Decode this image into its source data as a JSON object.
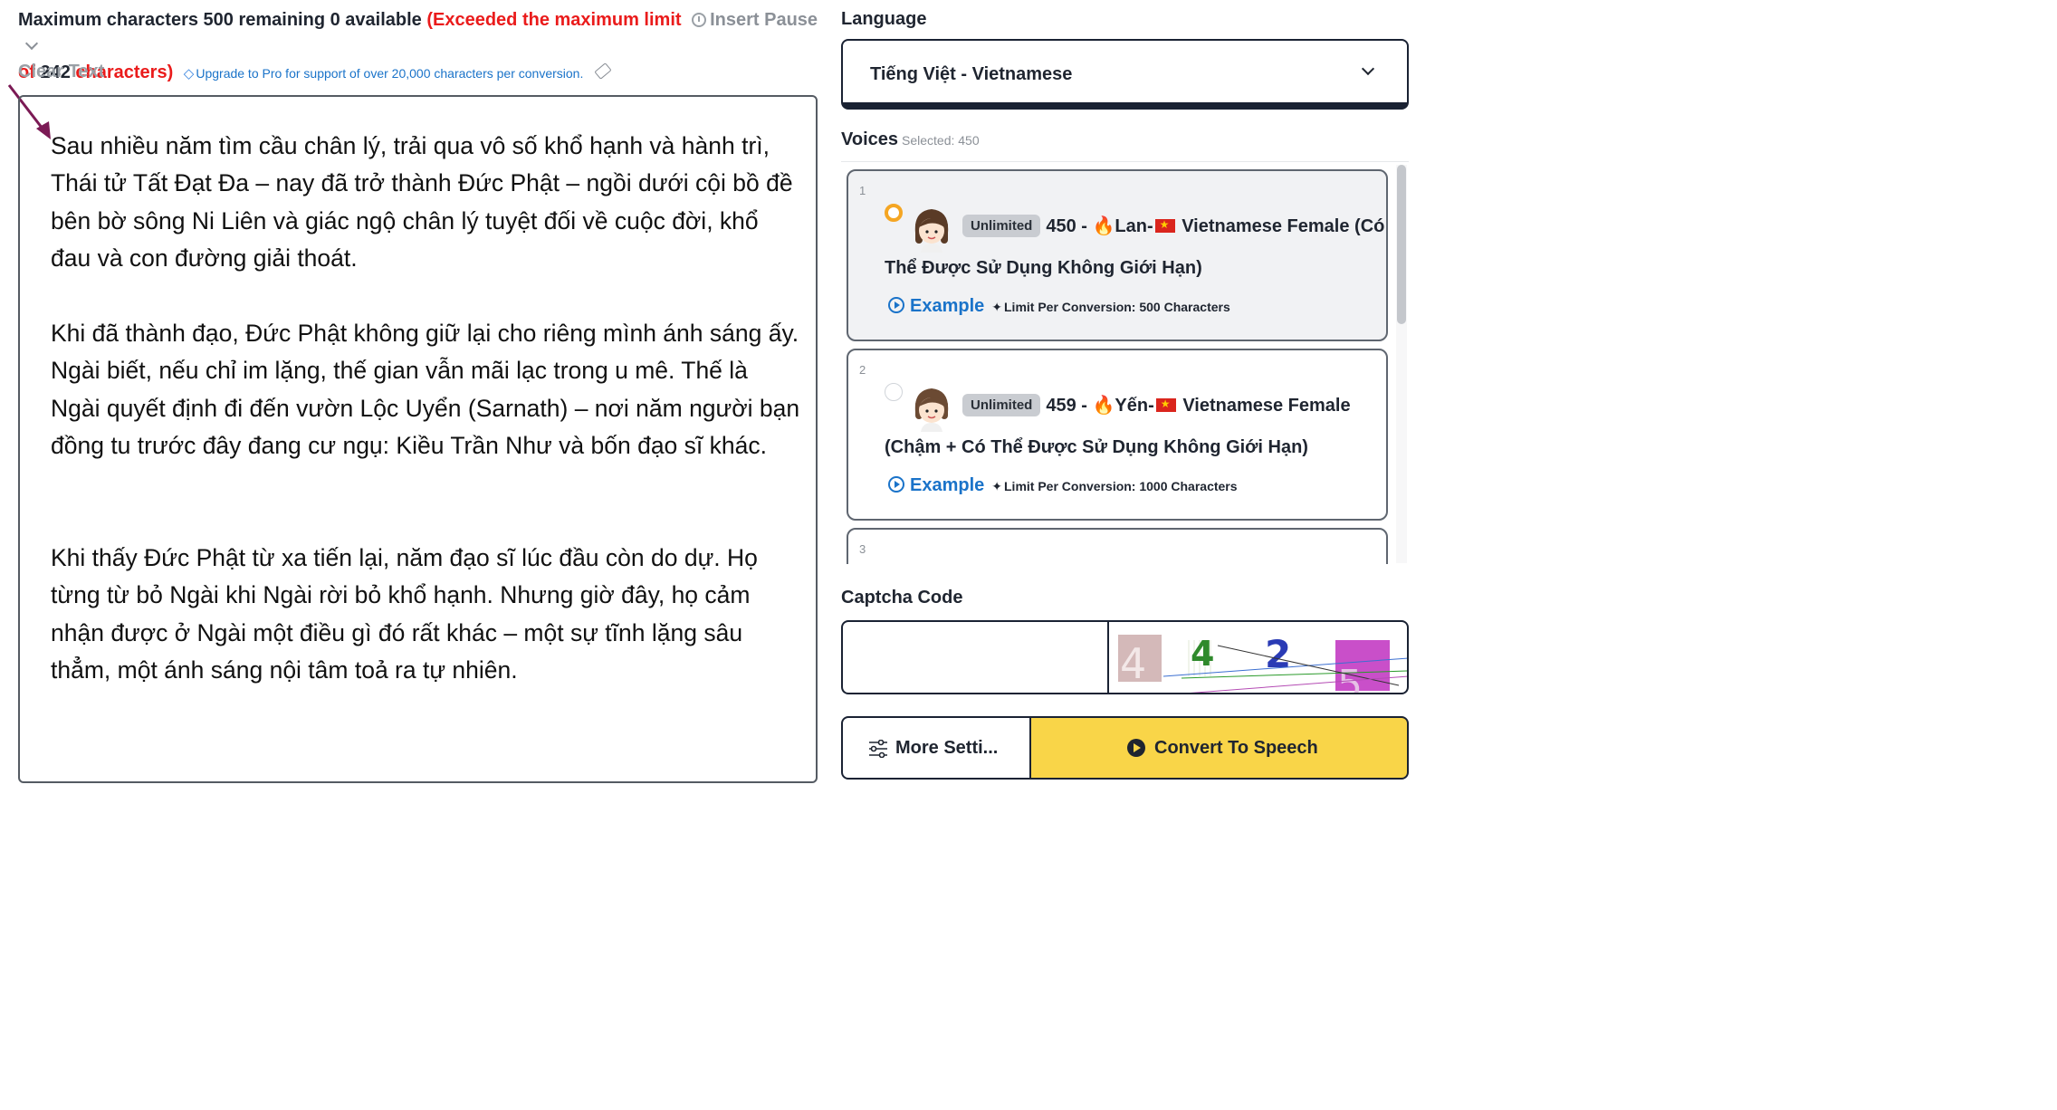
{
  "counter": {
    "max_text": "Maximum characters 500 remaining 0 available",
    "exceeded_1": "(Exceeded the maximum limit",
    "exceeded_2": "of",
    "exceeded_num": "242",
    "exceeded_3": "characters)",
    "insert_pause": "Insert Pause",
    "upgrade": "Upgrade to Pro for support of over 20,000 characters per conversion."
  },
  "clear_text": "Clear Text",
  "editor": {
    "paragraphs": [
      "Sau nhiều năm tìm cầu chân lý, trải qua vô số khổ hạnh và hành trì, Thái tử Tất Đạt Đa – nay đã trở thành Đức Phật – ngồi dưới cội bồ đề bên bờ sông Ni Liên và giác ngộ chân lý tuyệt đối về cuộc đời, khổ đau và con đường giải thoát.",
      "Khi đã thành đạo, Đức Phật không giữ lại cho riêng mình ánh sáng ấy. Ngài biết, nếu chỉ im lặng, thế gian vẫn mãi lạc trong u mê. Thế là Ngài quyết định đi đến vườn Lộc Uyển (Sarnath) – nơi năm người bạn đồng tu trước đây đang cư ngụ: Kiều Trần Như và bốn đạo sĩ khác.",
      "Khi thấy Đức Phật từ xa tiến lại, năm đạo sĩ lúc đầu còn do dự. Họ từng từ bỏ Ngài khi Ngài rời bỏ khổ hạnh. Nhưng giờ đây, họ cảm nhận được ở Ngài một điều gì đó rất khác – một sự tĩnh lặng sâu thẳm, một ánh sáng nội tâm toả ra tự nhiên."
    ]
  },
  "language": {
    "label": "Language",
    "selected": "Tiếng Việt - Vietnamese"
  },
  "voices": {
    "label": "Voices",
    "selected_text": "Selected: 450",
    "items": [
      {
        "num": "1",
        "badge": "Unlimited",
        "id_text": "450 -",
        "name": "Lan-",
        "desc_1": "Vietnamese Female (Có",
        "desc_2": "Thể Được Sử Dụng Không Giới Hạn)",
        "example": "Example",
        "limit": "Limit Per Conversion: 500 Characters",
        "selected": true
      },
      {
        "num": "2",
        "badge": "Unlimited",
        "id_text": "459 -",
        "name": "Yến-",
        "desc_1": "Vietnamese Female",
        "desc_2": "(Chậm + Có Thể Được Sử Dụng Không Giới Hạn)",
        "example": "Example",
        "limit": "Limit Per Conversion: 1000 Characters",
        "selected": false
      },
      {
        "num": "3"
      }
    ]
  },
  "captcha": {
    "label": "Captcha Code",
    "value": "",
    "digits": [
      "4",
      "4",
      "2",
      "5"
    ]
  },
  "buttons": {
    "more_settings": "More Setti...",
    "convert": "Convert To Speech"
  },
  "colors": {
    "accent_red": "#ea1b1b",
    "link_blue": "#1a73c9",
    "convert_yellow": "#f9d548",
    "radio_selected": "#f5a623"
  }
}
